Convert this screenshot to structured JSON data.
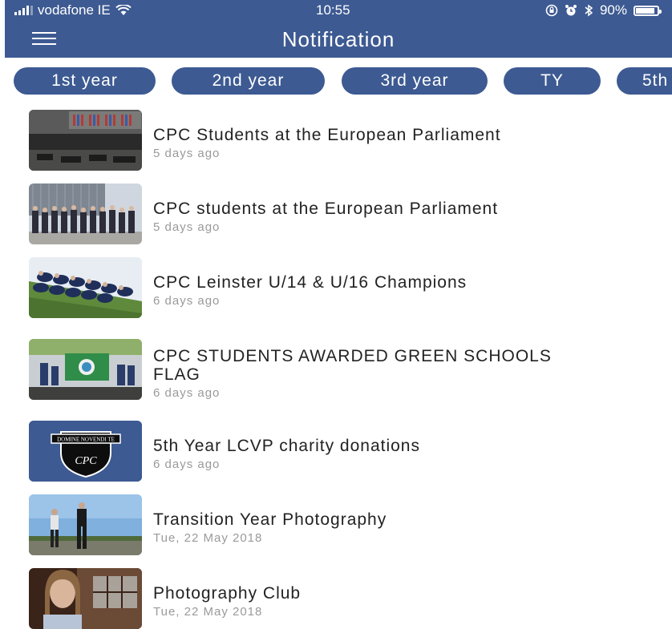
{
  "status_bar": {
    "carrier": "vodafone IE",
    "time": "10:55",
    "battery": "90%",
    "battery_level": 0.9,
    "icons": [
      "signal-icon",
      "wifi-icon",
      "orientation-lock-icon",
      "alarm-icon",
      "bluetooth-icon",
      "battery-icon"
    ]
  },
  "header": {
    "title": "Notification",
    "menu_icon": "hamburger-menu-icon"
  },
  "tabs": [
    {
      "label": "1st year"
    },
    {
      "label": "2nd year"
    },
    {
      "label": "3rd year"
    },
    {
      "label": "TY"
    },
    {
      "label": "5th"
    }
  ],
  "notifications": [
    {
      "title": "CPC Students at the European Parliament",
      "date": "5 days ago",
      "thumb": "parliament-hall-photo"
    },
    {
      "title": "CPC students at the European Parliament",
      "date": "5 days ago",
      "thumb": "students-outside-parliament-photo"
    },
    {
      "title": "CPC Leinster U/14 & U/16 Champions",
      "date": "6 days ago",
      "thumb": "team-photo"
    },
    {
      "title": "CPC STUDENTS AWARDED GREEN SCHOOLS FLAG",
      "date": "6 days ago",
      "thumb": "green-flag-photo"
    },
    {
      "title": "5th Year LCVP charity donations",
      "date": "6 days ago",
      "thumb": "school-crest-logo"
    },
    {
      "title": "Transition Year Photography",
      "date": "Tue, 22 May 2018",
      "thumb": "two-students-photo"
    },
    {
      "title": "Photography Club",
      "date": "Tue, 22 May 2018",
      "thumb": "portrait-photo"
    }
  ],
  "crest_text": "DOMINE NOVENDI TE",
  "crest_monogram": "CPC",
  "colors": {
    "brand": "#3d5a92",
    "date_text": "#9a9a9a",
    "title_text": "#222222"
  }
}
